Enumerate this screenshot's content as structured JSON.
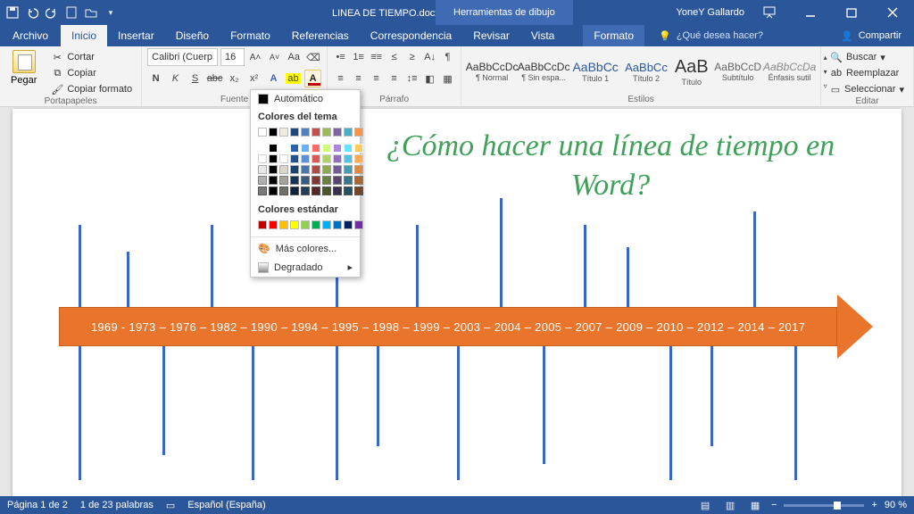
{
  "title": "LINEA DE TIEMPO.docx - Word",
  "drawing_tools": "Herramientas de dibujo",
  "user": "YoneY Gallardo",
  "file_tab": "Archivo",
  "tabs": [
    "Inicio",
    "Insertar",
    "Diseño",
    "Formato",
    "Referencias",
    "Correspondencia",
    "Revisar",
    "Vista"
  ],
  "format_tab": "Formato",
  "tell_me_placeholder": "¿Qué desea hacer?",
  "share": "Compartir",
  "clipboard": {
    "paste": "Pegar",
    "cut": "Cortar",
    "copy": "Copiar",
    "fmt": "Copiar formato",
    "group": "Portapapeles"
  },
  "font": {
    "family": "Calibri (Cuerp",
    "size": "16",
    "group": "Fuente"
  },
  "para": {
    "group": "Párrafo"
  },
  "styles": {
    "group": "Estilos",
    "items": [
      {
        "prev": "AaBbCcDc",
        "name": "¶ Normal"
      },
      {
        "prev": "AaBbCcDc",
        "name": "¶ Sin espa..."
      },
      {
        "prev": "AaBbCc",
        "name": "Título 1"
      },
      {
        "prev": "AaBbCc",
        "name": "Título 2"
      },
      {
        "prev": "AaB",
        "name": "Título"
      },
      {
        "prev": "AaBbCcD",
        "name": "Subtítulo"
      },
      {
        "prev": "AaBbCcDa",
        "name": "Énfasis sutil"
      }
    ]
  },
  "edit": {
    "find": "Buscar",
    "replace": "Reemplazar",
    "select": "Seleccionar",
    "group": "Editar"
  },
  "popup": {
    "automatic": "Automático",
    "theme": "Colores del tema",
    "standard": "Colores estándar",
    "more": "Más colores...",
    "gradient": "Degradado"
  },
  "doc_title": "¿Cómo hacer una línea de tiempo en Word?",
  "timeline_text": "1969 - 1973 – 1976 – 1982 – 1990 – 1994 – 1995 – 1998 – 1999 – 2003 – 2004 – 2005 – 2007 – 2009 – 2010 – 2012 – 2014 – 2017",
  "status": {
    "page": "Página 1 de 2",
    "words": "1 de 23 palabras",
    "lang": "Español (España)",
    "zoom": "90 %"
  },
  "theme_swatches_row0": [
    "#ffffff",
    "#000000",
    "#eeece1",
    "#1f497d",
    "#4f81bd",
    "#c0504d",
    "#9bbb59",
    "#8064a2",
    "#4bacc6",
    "#f79646"
  ],
  "std_swatches": [
    "#c00000",
    "#ff0000",
    "#ffc000",
    "#ffff00",
    "#92d050",
    "#00b050",
    "#00b0f0",
    "#0070c0",
    "#002060",
    "#7030a0"
  ]
}
